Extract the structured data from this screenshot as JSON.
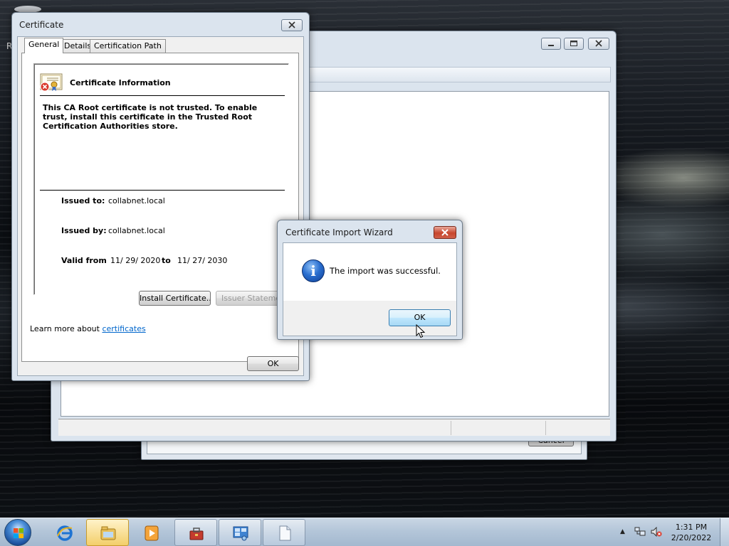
{
  "desktop": {
    "partial_label": "R"
  },
  "background_window": {
    "cancel_label": "Cancel"
  },
  "certificate_dialog": {
    "title": "Certificate",
    "tabs": [
      {
        "label": "General",
        "active": true
      },
      {
        "label": "Details",
        "active": false
      },
      {
        "label": "Certification Path",
        "active": false
      }
    ],
    "info_heading": "Certificate Information",
    "trust_message": "This CA Root certificate is not trusted. To enable trust, install this certificate in the Trusted Root Certification Authorities store.",
    "issued_to_label": "Issued to:",
    "issued_to_value": "collabnet.local",
    "issued_by_label": "Issued by:",
    "issued_by_value": "collabnet.local",
    "valid_from_label": "Valid from",
    "valid_from_value": "11/ 29/ 2020",
    "valid_to_label": "to",
    "valid_to_value": "11/ 27/ 2030",
    "install_button": "Install Certificate...",
    "issuer_statement_button": "Issuer Statement",
    "learn_more_text": "Learn more about",
    "learn_more_link": "certificates",
    "ok_button": "OK"
  },
  "import_wizard": {
    "title": "Certificate Import Wizard",
    "message": "The import was successful.",
    "ok_button": "OK",
    "icon": "info-icon"
  },
  "taskbar": {
    "items": [
      "start-orb",
      "internet-explorer-icon",
      "windows-explorer-icon",
      "media-player-icon",
      "certificate-toolbox-icon",
      "control-panel-icon",
      "document-icon"
    ],
    "clock_time": "1:31 PM",
    "clock_date": "2/20/2022"
  },
  "colors": {
    "taskbar": "#b4c6d9",
    "window_frame": "#dbe4ee",
    "link": "#0066cc",
    "close_button": "#c7462e"
  }
}
